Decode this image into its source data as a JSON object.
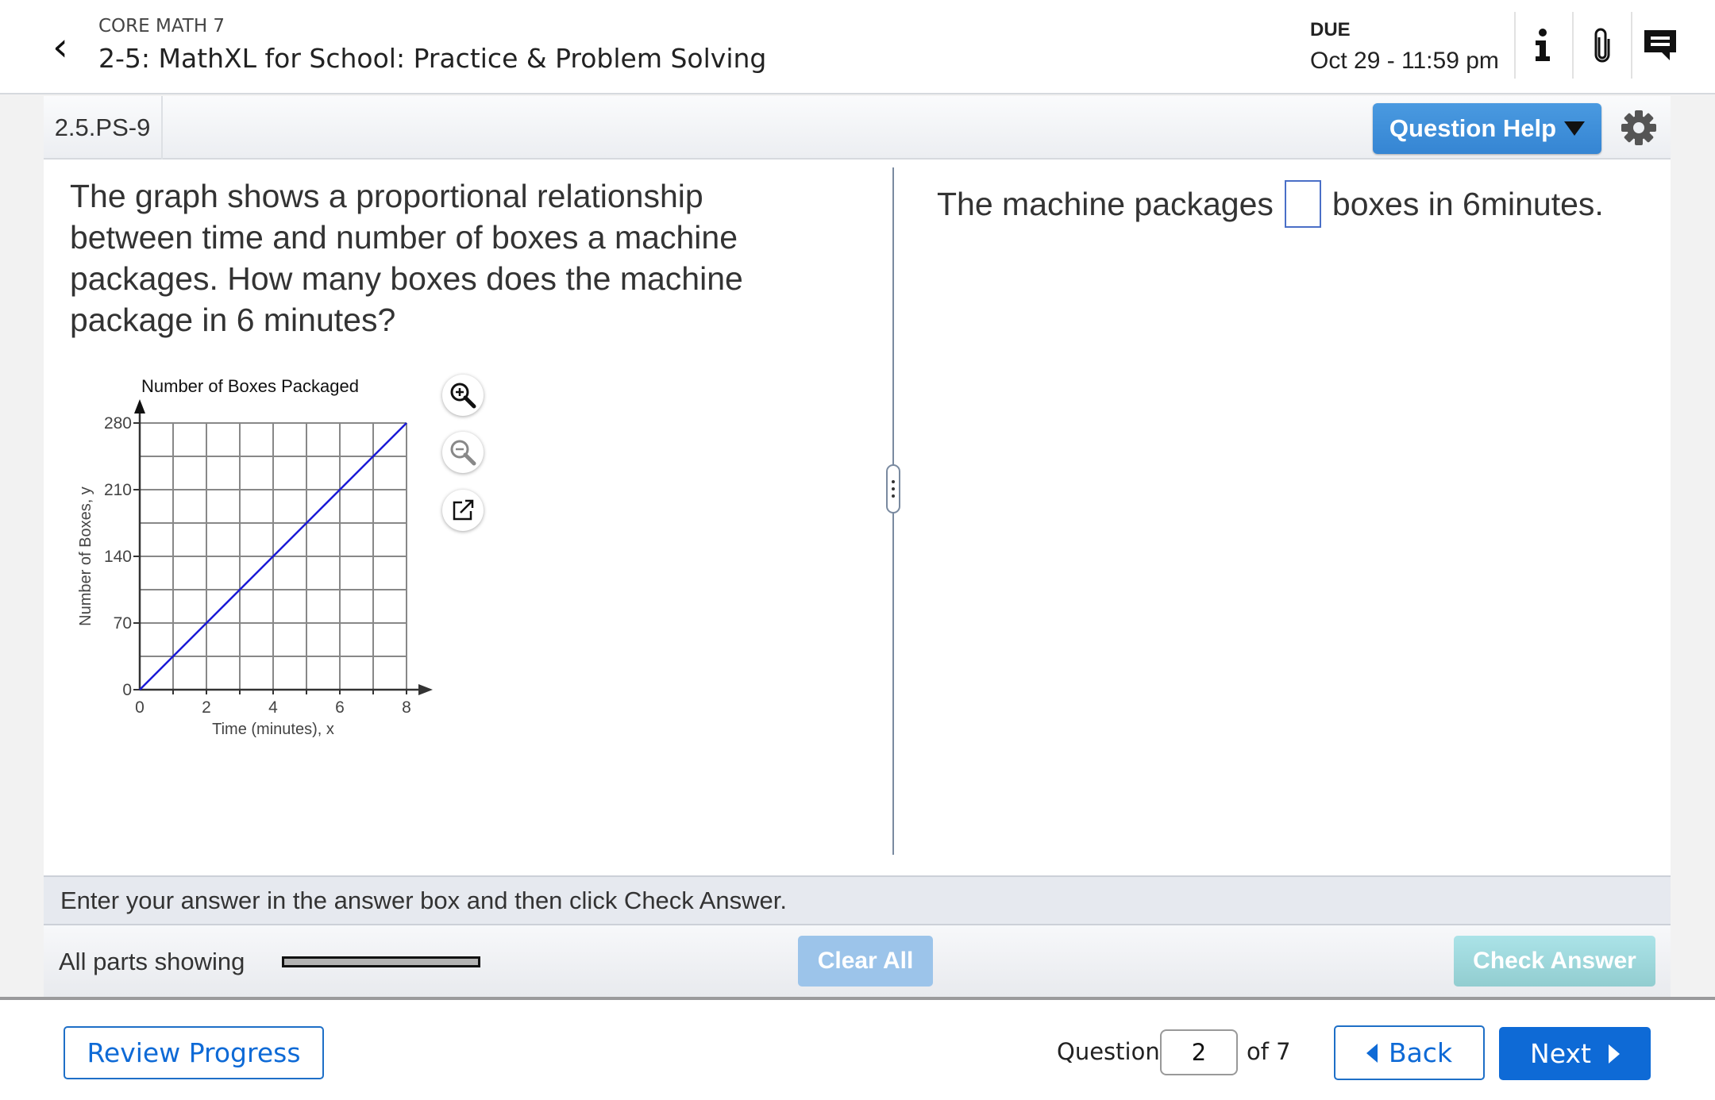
{
  "header": {
    "course": "CORE MATH 7",
    "assignment_title": "2-5: MathXL for School: Practice & Problem Solving",
    "due_label": "DUE",
    "due_value": "Oct 29 - 11:59 pm",
    "icons": [
      "info-icon",
      "paperclip-icon",
      "message-icon"
    ]
  },
  "toolbar": {
    "question_id": "2.5.PS-9",
    "question_help_label": "Question Help",
    "accent_color": "#3b8bd8"
  },
  "question": {
    "text": "The graph shows a proportional relationship between time and number of boxes a machine packages. How many boxes does the machine package in 6 minutes?",
    "answer_prefix": "The machine packages",
    "answer_value": "",
    "answer_suffix": "boxes in 6minutes."
  },
  "chart_data": {
    "type": "line",
    "title": "Number of Boxes Packaged",
    "xlabel": "Time (minutes), x",
    "ylabel": "Number of Boxes, y",
    "xlim": [
      0,
      8
    ],
    "ylim": [
      0,
      280
    ],
    "xticks": [
      0,
      2,
      4,
      6,
      8
    ],
    "yticks": [
      0,
      70,
      140,
      210,
      280
    ],
    "x_grid_step": 1,
    "y_grid_step": 35,
    "grid": true,
    "series": [
      {
        "x": [
          0,
          8
        ],
        "y": [
          0,
          280
        ],
        "color": "#1a1ad6"
      }
    ]
  },
  "graph_tools": [
    "zoom-in-icon",
    "zoom-out-icon",
    "open-external-icon"
  ],
  "instruction": "Enter your answer in the answer box and then click Check Answer.",
  "bottom": {
    "parts_label": "All parts showing",
    "clear_label": "Clear All",
    "check_label": "Check Answer"
  },
  "footer": {
    "review_label": "Review Progress",
    "question_label": "Question",
    "question_number": "2",
    "of_label": "of 7",
    "back_label": "Back",
    "next_label": "Next",
    "primary_color": "#0e6ad6"
  }
}
